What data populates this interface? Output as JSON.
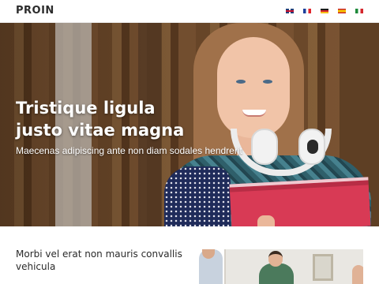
{
  "header": {
    "logo": "PROIN",
    "languages": [
      {
        "code": "en",
        "icon": "uk-flag-icon"
      },
      {
        "code": "fr",
        "icon": "france-flag-icon"
      },
      {
        "code": "de",
        "icon": "germany-flag-icon"
      },
      {
        "code": "es",
        "icon": "spain-flag-icon"
      },
      {
        "code": "it",
        "icon": "italy-flag-icon"
      }
    ]
  },
  "hero": {
    "title_line1": "Tristique ligula",
    "title_line2": "justo vitae magna",
    "subtitle": "Maecenas adipiscing ante non diam sodales hendrerit",
    "image": "student-girl-with-headphones-holding-book"
  },
  "section": {
    "heading": "Morbi vel erat non mauris convallis vehicula",
    "image": "people-in-office-photo"
  },
  "colors": {
    "text_dark": "#2a2a2a",
    "hero_text": "#ffffff",
    "background": "#ffffff"
  }
}
